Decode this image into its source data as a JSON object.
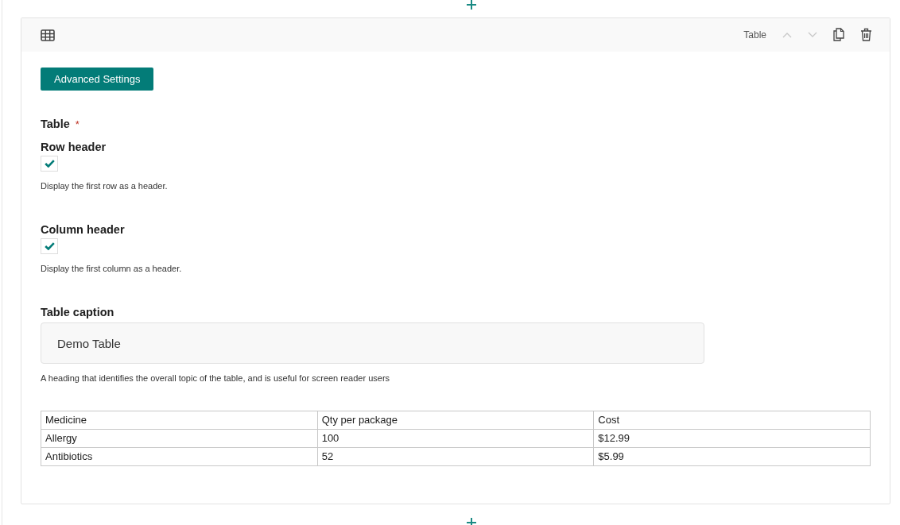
{
  "block": {
    "type_label": "Table",
    "move_up_disabled": true,
    "move_down_disabled": true
  },
  "advanced_button": "Advanced Settings",
  "table_label": {
    "text": "Table",
    "required_mark": "*"
  },
  "options": [
    {
      "label": "Row header",
      "checked": true,
      "help": "Display the first row as a header."
    },
    {
      "label": "Column header",
      "checked": true,
      "help": "Display the first column as a header."
    }
  ],
  "caption": {
    "label": "Table caption",
    "value": "Demo Table",
    "help": "A heading that identifies the overall topic of the table, and is useful for screen reader users"
  },
  "table": {
    "rows": [
      [
        "Medicine",
        "Qty per package",
        "Cost"
      ],
      [
        "Allergy",
        "100",
        "$12.99"
      ],
      [
        "Antibiotics",
        "52",
        "$5.99"
      ]
    ]
  }
}
